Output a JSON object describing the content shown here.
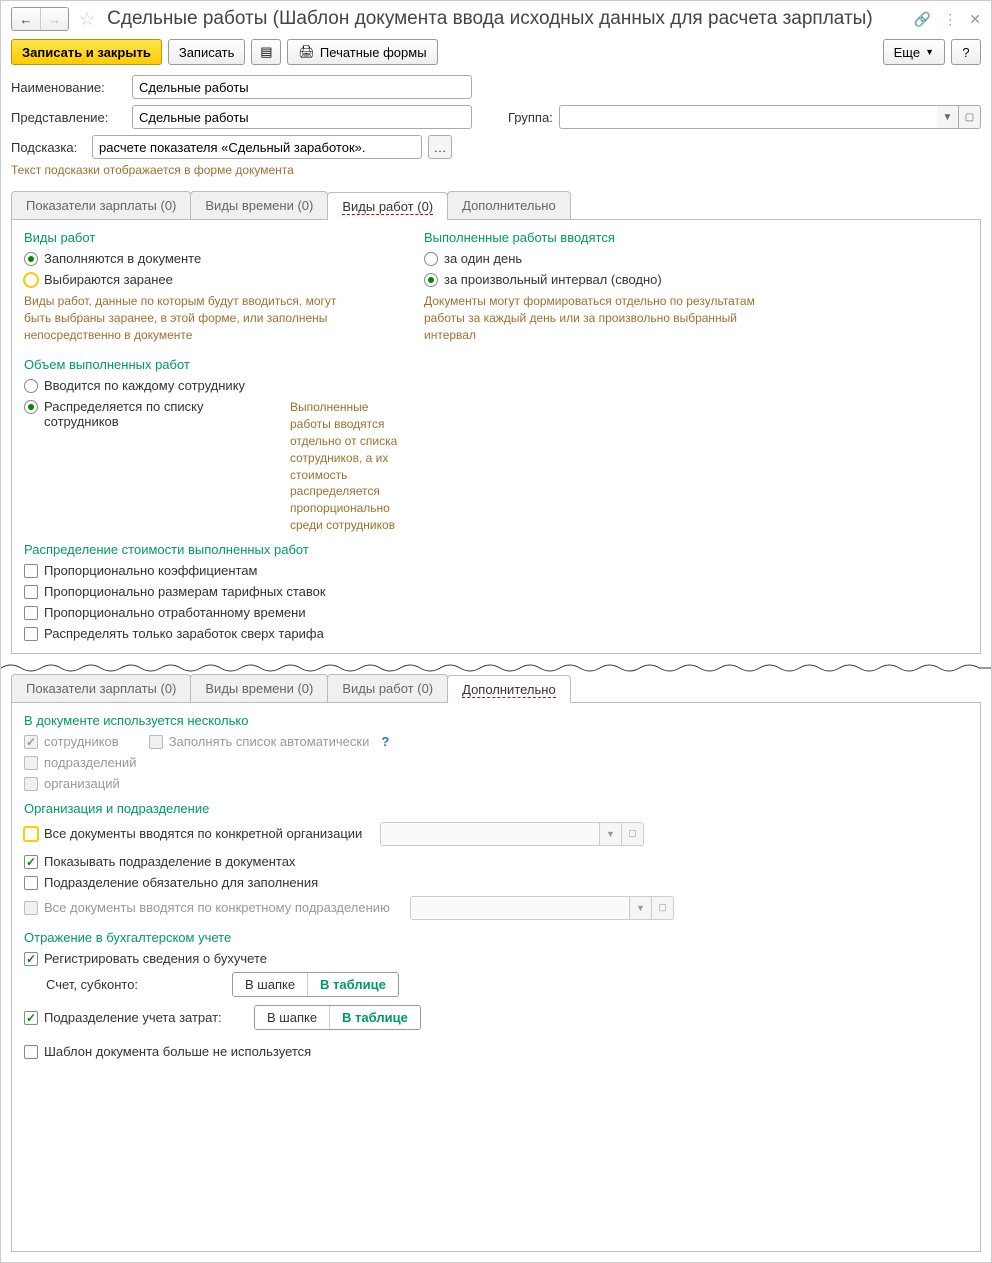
{
  "header": {
    "title": "Сдельные работы (Шаблон документа ввода исходных данных для расчета зарплаты)"
  },
  "toolbar": {
    "save_close": "Записать и закрыть",
    "save": "Записать",
    "print_forms": "Печатные формы",
    "more": "Еще",
    "help": "?"
  },
  "form": {
    "name_label": "Наименование:",
    "name_value": "Сдельные работы",
    "repr_label": "Представление:",
    "repr_value": "Сдельные работы",
    "group_label": "Группа:",
    "hint_label": "Подсказка:",
    "hint_value": "расчете показателя «Сдельный заработок».",
    "hint_note": "Текст подсказки отображается в форме документа"
  },
  "tabs1": {
    "t1": "Показатели зарплаты (0)",
    "t2": "Виды времени (0)",
    "t3": "Виды работ (0)",
    "t4": "Дополнительно"
  },
  "works": {
    "kinds_title": "Виды работ",
    "kinds_opt1": "Заполняются в документе",
    "kinds_opt2": "Выбираются заранее",
    "kinds_hint": "Виды работ, данные по которым будут вводиться, могут быть выбраны заранее, в этой форме, или заполнены непосредственно в документе",
    "done_title": "Выполненные работы вводятся",
    "done_opt1": "за один день",
    "done_opt2": "за произвольный интервал (сводно)",
    "done_hint": "Документы могут формироваться отдельно по результатам работы за каждый день или за произвольно выбранный интервал",
    "vol_title": "Объем выполненных работ",
    "vol_opt1": "Вводится по каждому сотруднику",
    "vol_opt2": "Распределяется по списку сотрудников",
    "vol_hint": "Выполненные работы вводятся отдельно от списка сотрудников, а их стоимость распределяется пропорционально среди сотрудников",
    "dist_title": "Распределение стоимости выполненных работ",
    "dist_c1": "Пропорционально коэффициентам",
    "dist_c2": "Пропорционально размерам тарифных ставок",
    "dist_c3": "Пропорционально отработанному времени",
    "dist_c4": "Распределять только заработок сверх тарифа"
  },
  "extra": {
    "doc_uses_title": "В документе используется несколько",
    "employees": "сотрудников",
    "autofill": "Заполнять список автоматически",
    "departments": "подразделений",
    "organizations": "организаций",
    "org_title": "Организация и подразделение",
    "all_docs_org": "Все документы вводятся по конкретной организации",
    "show_dept": "Показывать подразделение в документах",
    "dept_required": "Подразделение обязательно для заполнения",
    "all_docs_dept": "Все документы вводятся по конкретному подразделению",
    "acc_title": "Отражение в бухгалтерском учете",
    "reg_acc": "Регистрировать сведения о бухучете",
    "acc_subc": "Счет, субконто:",
    "dept_cost": "Подразделение учета затрат:",
    "in_header": "В шапке",
    "in_table": "В таблице",
    "not_used": "Шаблон документа больше не используется"
  }
}
